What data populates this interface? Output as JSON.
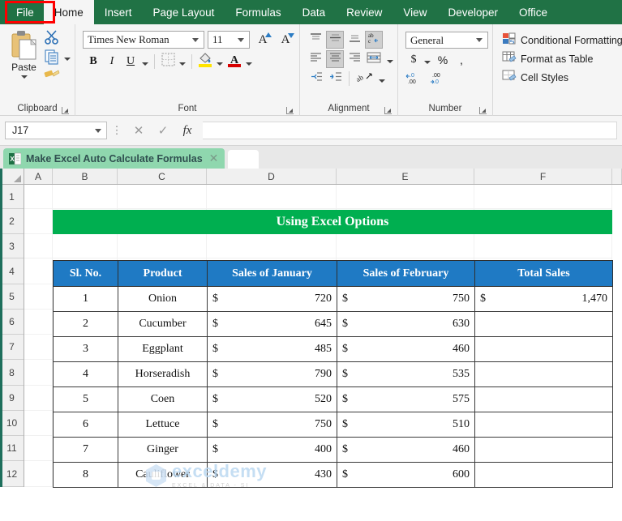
{
  "ribbon": {
    "tabs": [
      {
        "label": "File",
        "active": false,
        "highlighted": true
      },
      {
        "label": "Home",
        "active": true
      },
      {
        "label": "Insert",
        "active": false
      },
      {
        "label": "Page Layout",
        "active": false
      },
      {
        "label": "Formulas",
        "active": false
      },
      {
        "label": "Data",
        "active": false
      },
      {
        "label": "Review",
        "active": false
      },
      {
        "label": "View",
        "active": false
      },
      {
        "label": "Developer",
        "active": false
      },
      {
        "label": "Office",
        "active": false
      }
    ],
    "groups": {
      "clipboard": {
        "label": "Clipboard",
        "paste_label": "Paste",
        "paste_icon": "paste-clipboard-icon",
        "cut_icon": "scissors-cut-icon",
        "copy_icon": "copy-icon",
        "format_painter_icon": "format-painter-icon"
      },
      "font": {
        "label": "Font",
        "font_name": "Times New Roman",
        "font_size": "11",
        "grow_font": "A",
        "shrink_font": "A",
        "bold": "B",
        "italic": "I",
        "underline": "U",
        "borders_icon": "borders-icon",
        "fill_color_icon": "fill-color-icon",
        "font_color_icon": "font-color-icon"
      },
      "alignment": {
        "label": "Alignment",
        "top_align_icon": "align-top-icon",
        "middle_align_icon": "align-middle-icon",
        "bottom_align_icon": "align-bottom-icon",
        "align_left_icon": "align-left-icon",
        "align_center_icon": "align-center-icon",
        "align_right_icon": "align-right-icon",
        "wrap_text_icon": "wrap-text-icon",
        "merge_center_icon": "merge-and-center-icon",
        "decrease_indent_icon": "decrease-indent-icon",
        "increase_indent_icon": "increase-indent-icon",
        "orientation_icon": "text-orientation-icon"
      },
      "number": {
        "label": "Number",
        "format": "General",
        "currency": "$",
        "percent": "%",
        "comma": ",",
        "increase_decimal": "increase-decimal-icon",
        "decrease_decimal": "decrease-decimal-icon"
      },
      "styles": {
        "conditional_formatting": "Conditional Formatting",
        "format_as_table": "Format as Table",
        "cell_styles": "Cell Styles"
      }
    }
  },
  "formula_bar": {
    "name_box": "J17",
    "cancel_icon": "cancel-icon",
    "enter_icon": "confirm-check-icon",
    "function_icon": "fx",
    "formula_value": ""
  },
  "workbook_tab": {
    "title": "Make Excel Auto Calculate Formulas",
    "icon": "excel-file-icon",
    "close_icon": "close-icon",
    "new_tab_icon": "new-tab-icon"
  },
  "grid": {
    "columns": [
      "A",
      "B",
      "C",
      "D",
      "E",
      "F"
    ],
    "rows": [
      "1",
      "2",
      "3",
      "4",
      "5",
      "6",
      "7",
      "8",
      "9",
      "10",
      "11",
      "12"
    ]
  },
  "sheet": {
    "banner_title": "Using Excel Options",
    "banner_color": "#00af50",
    "header_color": "#1f7ac4",
    "table": {
      "headers": [
        "Sl. No.",
        "Product",
        "Sales of January",
        "Sales of February",
        "Total Sales"
      ],
      "currency_symbol": "$",
      "rows": [
        {
          "sl": "1",
          "product": "Onion",
          "jan": "720",
          "feb": "750",
          "total": "1,470"
        },
        {
          "sl": "2",
          "product": "Cucumber",
          "jan": "645",
          "feb": "630",
          "total": ""
        },
        {
          "sl": "3",
          "product": "Eggplant",
          "jan": "485",
          "feb": "460",
          "total": ""
        },
        {
          "sl": "4",
          "product": "Horseradish",
          "jan": "790",
          "feb": "535",
          "total": ""
        },
        {
          "sl": "5",
          "product": "Coen",
          "jan": "520",
          "feb": "575",
          "total": ""
        },
        {
          "sl": "6",
          "product": "Lettuce",
          "jan": "750",
          "feb": "510",
          "total": ""
        },
        {
          "sl": "7",
          "product": "Ginger",
          "jan": "400",
          "feb": "460",
          "total": ""
        },
        {
          "sl": "8",
          "product": "Cauliflower",
          "jan": "430",
          "feb": "600",
          "total": ""
        }
      ]
    }
  },
  "watermark": {
    "main": "exceldemy",
    "sub": "EXCEL & DATA - SI"
  }
}
